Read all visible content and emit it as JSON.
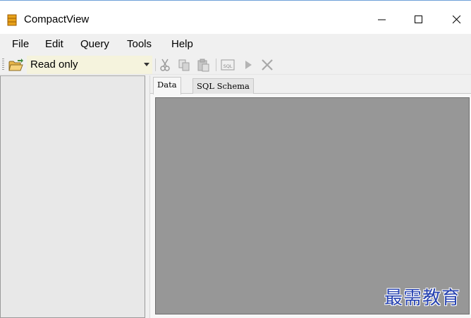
{
  "window": {
    "title": "CompactView",
    "controls": {
      "minimize": "—",
      "maximize": "☐",
      "close": "✕"
    }
  },
  "menu": {
    "items": [
      "File",
      "Edit",
      "Query",
      "Tools",
      "Help"
    ]
  },
  "toolbar": {
    "mode_selected": "Read only",
    "icons": [
      "open-folder-icon",
      "cut-icon",
      "copy-icon",
      "paste-icon",
      "sql-icon",
      "run-icon",
      "stop-icon"
    ],
    "sql_icon_text": "SQL"
  },
  "tabs": {
    "items": [
      "Data",
      "SQL Schema"
    ],
    "active": "Data"
  },
  "watermark": {
    "text": "最需教育"
  },
  "colors": {
    "grid_background": "#979797",
    "mode_select_background": "#f5f3dd",
    "watermark": "#2742b0"
  }
}
